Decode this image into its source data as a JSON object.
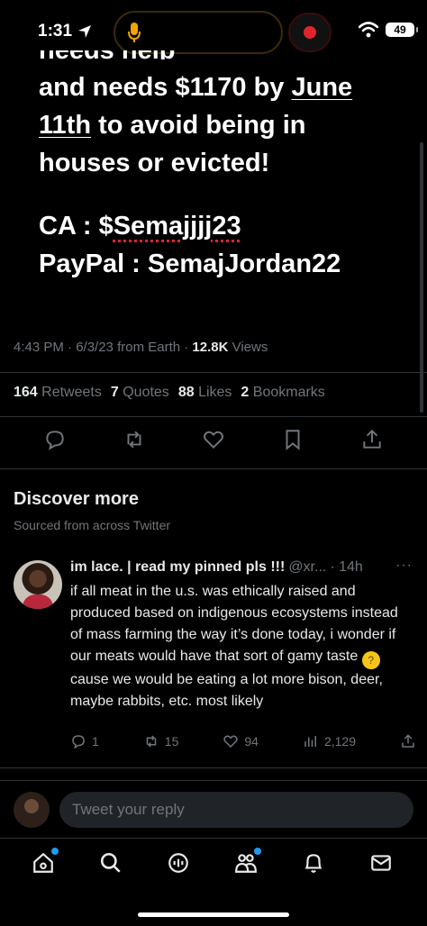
{
  "status_bar": {
    "time": "1:31",
    "battery": "49"
  },
  "tweet": {
    "partial_line": "needs help",
    "line1_pre": "and needs $1170 by ",
    "line1_june": "June",
    "line2_date": "11th",
    "line2_post": " to avoid being in",
    "line3": "houses or evicted!",
    "ca_prefix": "CA : $",
    "ca_handle": "Semajjjj23",
    "paypal": "PayPal : SemajJordan22",
    "meta_time": "4:43 PM · 6/3/23 from Earth · ",
    "meta_views_count": "12.8K",
    "meta_views_label": " Views",
    "stats": [
      {
        "count": "164",
        "label": "Retweets"
      },
      {
        "count": "7",
        "label": "Quotes"
      },
      {
        "count": "88",
        "label": "Likes"
      },
      {
        "count": "2",
        "label": "Bookmarks"
      }
    ]
  },
  "discover": {
    "title": "Discover more",
    "subtitle": "Sourced from across Twitter"
  },
  "rec_tweet": {
    "name": "im lace. | read my pinned pls !!!",
    "handle": "@xr...",
    "time": "· 14h",
    "more": "···",
    "body_before_emoji": "if all meat in the u.s. was ethically raised and produced based on indigenous ecosystems instead of mass farming the way it’s done today, i wonder if our meats would have that sort of gamy taste ",
    "body_after_emoji": " cause we would be eating a lot more bison, deer, maybe rabbits, etc. most likely",
    "replies": "1",
    "retweets": "15",
    "likes": "94",
    "views": "2,129"
  },
  "reply_bar": {
    "placeholder": "Tweet your reply"
  },
  "colors": {
    "accent": "#1d9bf0",
    "background": "#000000",
    "muted": "#71767b"
  },
  "icons": {
    "actions": [
      "reply-icon",
      "retweet-icon",
      "like-icon",
      "bookmark-icon",
      "share-icon"
    ],
    "tabs": [
      "home-icon",
      "search-icon",
      "spaces-icon",
      "communities-icon",
      "notifications-icon",
      "messages-icon"
    ]
  }
}
